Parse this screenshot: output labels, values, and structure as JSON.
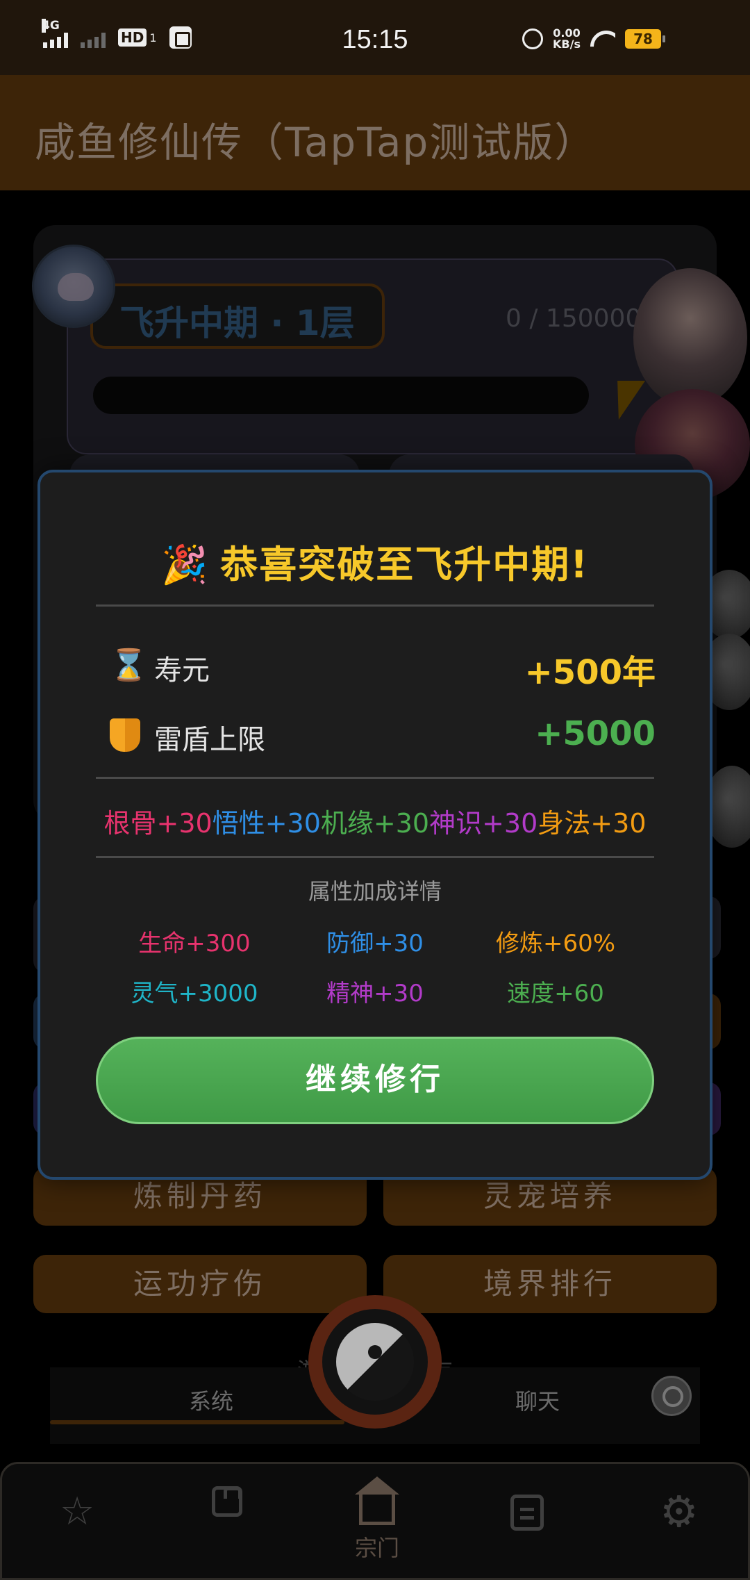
{
  "status_bar": {
    "network_tag": "4G",
    "hd_label": "HD",
    "hd_sub": "1",
    "time": "15:15",
    "net_speed_value": "0.00",
    "net_speed_unit": "KB/s",
    "battery": "78"
  },
  "app": {
    "title": "咸鱼修仙传（TapTap测试版）"
  },
  "background": {
    "realm_label": "飞升中期 · 1层",
    "exp_text": "0 / 1500000",
    "buttons": [
      "炼制丹药",
      "灵宠培养",
      "运功疗伤",
      "境界排行"
    ],
    "autosave_text": "游戏已自动保存",
    "tabs": [
      "系统",
      "聊天"
    ]
  },
  "bottom_nav": {
    "items": [
      {
        "icon": "star-icon",
        "label": ""
      },
      {
        "icon": "bag-icon",
        "label": ""
      },
      {
        "icon": "sect-home-icon",
        "label": "宗门"
      },
      {
        "icon": "document-icon",
        "label": ""
      },
      {
        "icon": "gear-icon",
        "label": ""
      }
    ]
  },
  "modal": {
    "title_icon": "🎉",
    "title": "恭喜突破至飞升中期!",
    "rewards": [
      {
        "icon": "hourglass-icon",
        "icon_glyph": "⌛",
        "label": "寿元",
        "value": "+500年",
        "color": "#f7c82a"
      },
      {
        "icon": "shield-icon",
        "label": "雷盾上限",
        "value": "+5000",
        "color": "#4caf50"
      }
    ],
    "attributes": [
      {
        "text": "根骨+30",
        "color": "#e8336e"
      },
      {
        "text": "悟性+30",
        "color": "#2f8fe6"
      },
      {
        "text": "机缘+30",
        "color": "#4caf50"
      },
      {
        "text": "神识+30",
        "color": "#b23bc9"
      },
      {
        "text": "身法+30",
        "color": "#f39c12"
      }
    ],
    "detail_title": "属性加成详情",
    "details": [
      {
        "text": "生命+300",
        "color": "#e8336e"
      },
      {
        "text": "防御+30",
        "color": "#2f8fe6"
      },
      {
        "text": "修炼+60%",
        "color": "#f39c12"
      },
      {
        "text": "灵气+3000",
        "color": "#1fb5c8"
      },
      {
        "text": "精神+30",
        "color": "#b23bc9"
      },
      {
        "text": "速度+60",
        "color": "#4caf50"
      }
    ],
    "continue_label": "继续修行"
  }
}
